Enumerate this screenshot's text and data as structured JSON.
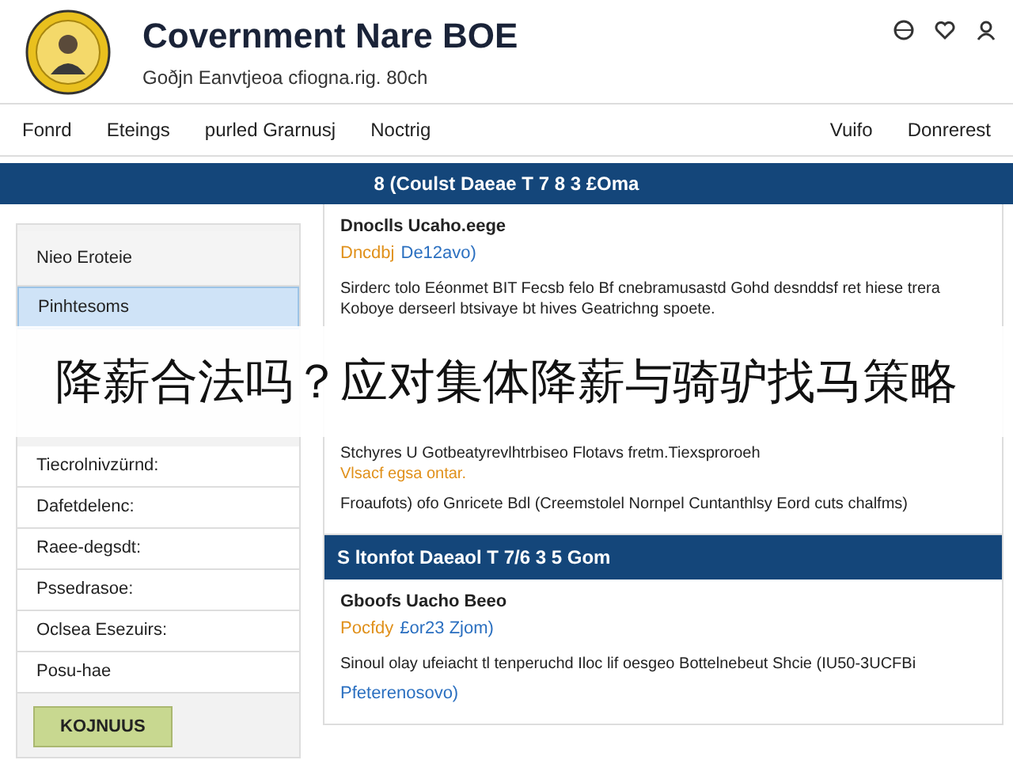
{
  "header": {
    "title": "Covernment Nare BOE",
    "subtitle": "Goðjn Eanvtjeoa cfiogna.rig. 80ch"
  },
  "nav": {
    "left": [
      "Fonrd",
      "Eteings",
      "purled Grarnusj",
      "Noctrig"
    ],
    "right": [
      "Vuifo",
      "Donrerest"
    ]
  },
  "banner": "8 (Coulst Daeae T 7 8 3 £Oma",
  "sidebar": {
    "items": [
      {
        "label": "Nieo Eroteie",
        "selected": false
      },
      {
        "label": "Pinhtesoms",
        "selected": true
      },
      {
        "label": "Tiecrolnivzürnd:",
        "selected": false
      },
      {
        "label": "Dafetdelenc:",
        "selected": false
      },
      {
        "label": "Raee-degsdt:",
        "selected": false
      },
      {
        "label": "Pssedrasoe:",
        "selected": false
      },
      {
        "label": "Oclsea Esezuirs:",
        "selected": false
      },
      {
        "label": "Posu-hae",
        "selected": false
      }
    ],
    "button": "KOJNUUS"
  },
  "sections": [
    {
      "entries": [
        {
          "title": "Dnoclls Ucaho.eege",
          "source": "Dncdbj",
          "date": "De12avo)",
          "lines": [
            {
              "kind": "body",
              "text": "Sirderc tolo Eéonmet BIT Fecsb felo Bf cnebramusastd Gohd desnddsf ret hiese trera Koboye derseerl btsivaye bt hives Geatrichng spoete."
            },
            {
              "kind": "body",
              "text": "Stchyres U Gotbeatyrevlhtrbiseo Flotavs fretm.Tiexsproroeh"
            },
            {
              "kind": "accent",
              "text": "Vlsacf egsa ontar."
            },
            {
              "kind": "body",
              "text": "Froaufots) ofo Gnricete Bdl (Creemstolel Nornpel Cuntanthlsy Eord cuts chalfms)"
            }
          ]
        }
      ]
    },
    {
      "heading": "S ltonfot Daeaol T 7/6 3 5 Gom",
      "entries": [
        {
          "title": "Gboofs Uacho Beeo",
          "source": "Pocfdy",
          "date": "£or23 Zjom)",
          "lines": [
            {
              "kind": "body",
              "text": "Sinoul olay ufeiacht tl tenperuchd Iloc lif oesgeo Bottelnebeut Shcie (IU50-3UCFBi"
            },
            {
              "kind": "link",
              "text": "Pfeterenosovo)"
            }
          ]
        }
      ]
    }
  ],
  "overlay_caption": "降薪合法吗？应对集体降薪与骑驴找马策略"
}
